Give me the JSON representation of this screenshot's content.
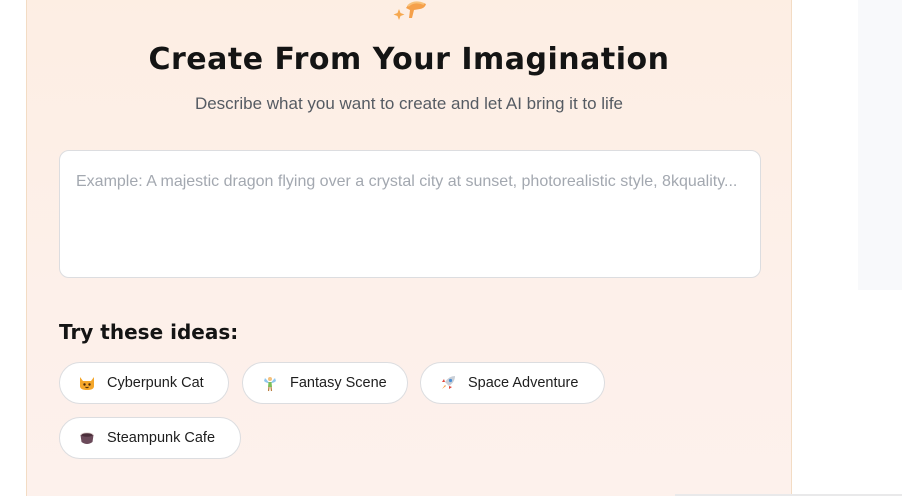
{
  "header": {
    "icon": "sparkle-mushroom-icon",
    "title": "Create From Your Imagination",
    "subtitle": "Describe what you want to create and let AI bring it to life"
  },
  "prompt": {
    "value": "",
    "placeholder": "Example: A majestic dragon flying over a crystal city at sunset, photorealistic style, 8kquality..."
  },
  "ideas": {
    "heading": "Try these ideas:",
    "items": [
      {
        "label": "Cyberpunk Cat",
        "icon": "cat-icon"
      },
      {
        "label": "Fantasy Scene",
        "icon": "fairy-icon"
      },
      {
        "label": "Space Adventure",
        "icon": "rocket-icon"
      },
      {
        "label": "Steampunk Cafe",
        "icon": "coffee-icon"
      }
    ]
  },
  "colors": {
    "card_background": "#fdeee3",
    "title": "#141414",
    "subtitle": "#555b63",
    "placeholder": "#a3a8b0",
    "border": "#dcdde0"
  }
}
